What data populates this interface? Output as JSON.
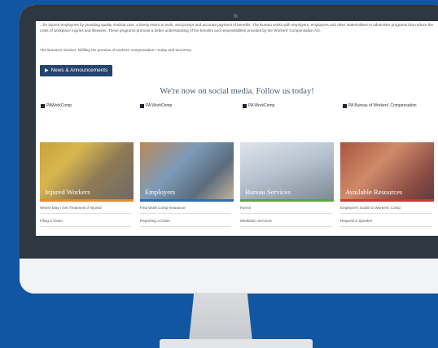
{
  "intro": {
    "paragraph": "...for injured employees by providing quality medical care, a timely return to work, and prompt and accurate payment of benefits. The Bureau works with employers, employees and other stakeholders to administer programs that reduce the costs of workplace injuries and illnesses. These programs promote a better understanding of the benefits and responsibilities provided by the Workers' Compensation Act.",
    "mission": "The Bureau's mission: fulfilling the promise of workers' compensation—today and tomorrow."
  },
  "news_button": {
    "label": "News & Announcements",
    "icon": "megaphone-icon"
  },
  "social": {
    "heading": "We're now on social media. Follow us today!",
    "links": [
      {
        "label": "PAWorkComp",
        "icon": "facebook-icon"
      },
      {
        "label": "PA WorkComp",
        "icon": "twitter-icon"
      },
      {
        "label": "PA WorkComp",
        "icon": "youtube-icon"
      },
      {
        "label": "PA Bureau of Workers' Compensation",
        "icon": "linkedin-icon"
      }
    ]
  },
  "cards": [
    {
      "title": "Injured Workers",
      "bar_color": "#e8892b",
      "links": [
        "Where May I Get Treatment if Injured",
        "Filing a Claim"
      ]
    },
    {
      "title": "Employers",
      "bar_color": "#2a6fb0",
      "links": [
        "Find Work Comp Insurance",
        "Reporting a Claim"
      ]
    },
    {
      "title": "Bureau Services",
      "bar_color": "#5da33a",
      "links": [
        "Forms",
        "Mediation Services"
      ]
    },
    {
      "title": "Available Resources",
      "bar_color": "#c93a32",
      "links": [
        "Employer's Guide to Workers' Comp",
        "Request a Speaker"
      ]
    }
  ]
}
